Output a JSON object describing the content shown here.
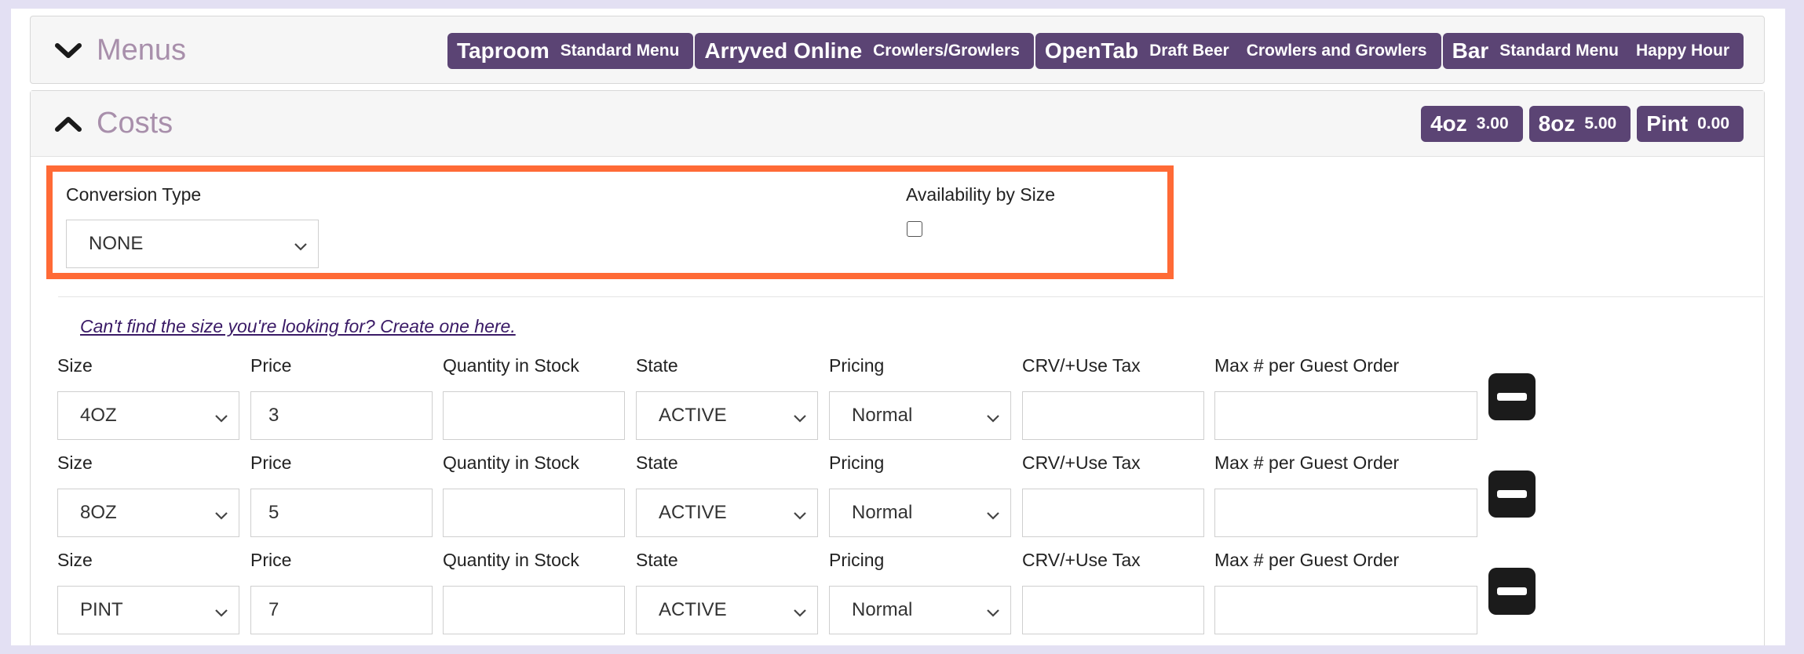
{
  "menus": {
    "title": "Menus",
    "groups": [
      {
        "name": "Taproom",
        "items": [
          "Standard Menu"
        ]
      },
      {
        "name": "Arryved Online",
        "items": [
          "Crowlers/Growlers"
        ]
      },
      {
        "name": "OpenTab",
        "items": [
          "Draft Beer",
          "Crowlers and Growlers"
        ]
      },
      {
        "name": "Bar",
        "items": [
          "Standard Menu",
          "Happy Hour"
        ]
      }
    ]
  },
  "costs": {
    "title": "Costs",
    "summary": [
      {
        "size": "4oz",
        "price": "3.00"
      },
      {
        "size": "8oz",
        "price": "5.00"
      },
      {
        "size": "Pint",
        "price": "0.00"
      }
    ],
    "conversion_type_label": "Conversion Type",
    "conversion_type_value": "NONE",
    "availability_label": "Availability by Size",
    "availability_checked": false,
    "create_size_link": "Can't find the size you're looking for? Create one here.",
    "columns": {
      "size": "Size",
      "price": "Price",
      "quantity": "Quantity in Stock",
      "state": "State",
      "pricing": "Pricing",
      "crv": "CRV/+Use Tax",
      "max": "Max # per Guest Order"
    },
    "rows": [
      {
        "size": "4OZ",
        "price": "3",
        "quantity": "",
        "state": "ACTIVE",
        "pricing": "Normal",
        "crv": "",
        "max": ""
      },
      {
        "size": "8OZ",
        "price": "5",
        "quantity": "",
        "state": "ACTIVE",
        "pricing": "Normal",
        "crv": "",
        "max": ""
      },
      {
        "size": "PINT",
        "price": "7",
        "quantity": "",
        "state": "ACTIVE",
        "pricing": "Normal",
        "crv": "",
        "max": ""
      }
    ]
  },
  "colors": {
    "badge_bg": "#5b4474",
    "title_color": "#a88fab",
    "highlight": "#ff6a36",
    "remove_button": "#1b1b1b"
  },
  "icons": {
    "menus_toggle": "chevron-down-icon",
    "costs_toggle": "chevron-up-icon",
    "select_caret": "chevron-down-icon",
    "remove_row": "minus-icon"
  }
}
